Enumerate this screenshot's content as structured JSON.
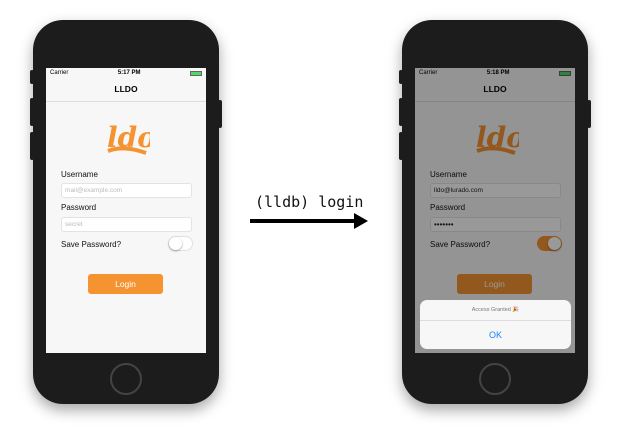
{
  "before": {
    "carrier": "Carrier",
    "time": "5:17 PM",
    "title": "LLDO",
    "logo_text": "lldo",
    "username_label": "Username",
    "username_placeholder": "mail@example.com",
    "password_label": "Password",
    "password_placeholder": "secret",
    "save_label": "Save Password?",
    "save_on": false,
    "login_label": "Login"
  },
  "command": "(lldb) login",
  "after": {
    "carrier": "Carrier",
    "time": "5:18 PM",
    "title": "LLDO",
    "logo_text": "lldo",
    "username_label": "Username",
    "username_value": "lldo@lurado.com",
    "password_label": "Password",
    "password_value": "•••••••",
    "save_label": "Save Password?",
    "save_on": true,
    "login_label": "Login",
    "alert_message": "Access Granted 🎉",
    "alert_ok": "OK"
  },
  "colors": {
    "accent": "#f59331",
    "link": "#1a82fb"
  }
}
